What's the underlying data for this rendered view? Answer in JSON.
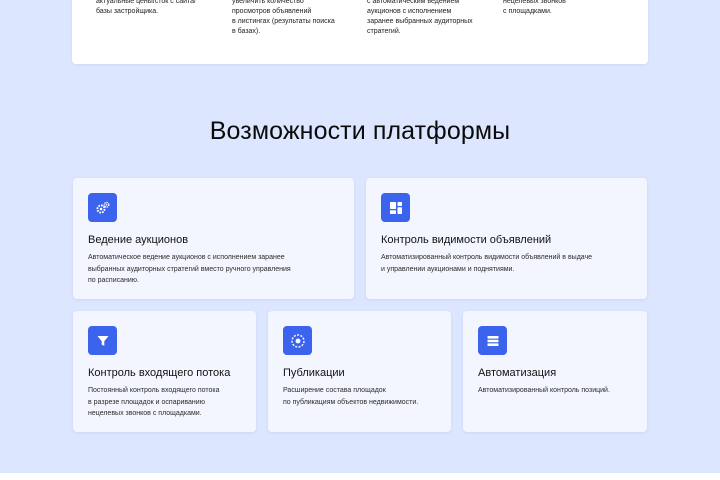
{
  "top_card": {
    "columns": [
      "актуальные цены/сток с сайта/\nбазы застройщика.",
      "увеличить количество\nпросмотров объявлений\nв листингах (результаты поиска\nв базах).",
      "с автоматическим ведением\nаукционов с исполнением\nзаранее выбранных аудиторных\nстратегий.",
      "нецелевых звонков\nс площадками."
    ]
  },
  "section": {
    "title": "Возможности платформы"
  },
  "cards": [
    {
      "icon": "gears-icon",
      "title": "Ведение аукционов",
      "description": "Автоматическое ведение аукционов с исполнением заранее\nвыбранных аудиторных стратегий вместо ручного управления\nпо расписанию."
    },
    {
      "icon": "layout-grid-icon",
      "title": "Контроль видимости объявлений",
      "description": "Автоматизированный контроль видимости объявлений в выдаче\nи управлении аукционами и поднятиями."
    },
    {
      "icon": "funnel-icon",
      "title": "Контроль входящего потока",
      "description": "Постоянный контроль входящего потока\nв разрезе площадок и оспариванию\nнецелевых звонков с площадками."
    },
    {
      "icon": "target-circle-icon",
      "title": "Публикации",
      "description": "Расширение состава площадок\nпо публикациям объектов недвижимости."
    },
    {
      "icon": "list-rows-icon",
      "title": "Автоматизация",
      "description": "Автоматизированный контроль позиций."
    }
  ],
  "colors": {
    "page_background": "#dde6ff",
    "card_background": "#f3f6ff",
    "accent": "#3b63ee"
  }
}
